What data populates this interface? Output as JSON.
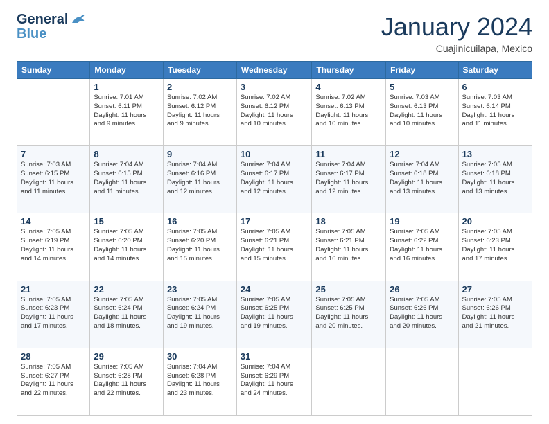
{
  "header": {
    "logo_line1": "General",
    "logo_line2": "Blue",
    "month_title": "January 2024",
    "location": "Cuajinicuilapa, Mexico"
  },
  "weekdays": [
    "Sunday",
    "Monday",
    "Tuesday",
    "Wednesday",
    "Thursday",
    "Friday",
    "Saturday"
  ],
  "weeks": [
    [
      {
        "day": "",
        "info": ""
      },
      {
        "day": "1",
        "info": "Sunrise: 7:01 AM\nSunset: 6:11 PM\nDaylight: 11 hours\nand 9 minutes."
      },
      {
        "day": "2",
        "info": "Sunrise: 7:02 AM\nSunset: 6:12 PM\nDaylight: 11 hours\nand 9 minutes."
      },
      {
        "day": "3",
        "info": "Sunrise: 7:02 AM\nSunset: 6:12 PM\nDaylight: 11 hours\nand 10 minutes."
      },
      {
        "day": "4",
        "info": "Sunrise: 7:02 AM\nSunset: 6:13 PM\nDaylight: 11 hours\nand 10 minutes."
      },
      {
        "day": "5",
        "info": "Sunrise: 7:03 AM\nSunset: 6:13 PM\nDaylight: 11 hours\nand 10 minutes."
      },
      {
        "day": "6",
        "info": "Sunrise: 7:03 AM\nSunset: 6:14 PM\nDaylight: 11 hours\nand 11 minutes."
      }
    ],
    [
      {
        "day": "7",
        "info": "Sunrise: 7:03 AM\nSunset: 6:15 PM\nDaylight: 11 hours\nand 11 minutes."
      },
      {
        "day": "8",
        "info": "Sunrise: 7:04 AM\nSunset: 6:15 PM\nDaylight: 11 hours\nand 11 minutes."
      },
      {
        "day": "9",
        "info": "Sunrise: 7:04 AM\nSunset: 6:16 PM\nDaylight: 11 hours\nand 12 minutes."
      },
      {
        "day": "10",
        "info": "Sunrise: 7:04 AM\nSunset: 6:17 PM\nDaylight: 11 hours\nand 12 minutes."
      },
      {
        "day": "11",
        "info": "Sunrise: 7:04 AM\nSunset: 6:17 PM\nDaylight: 11 hours\nand 12 minutes."
      },
      {
        "day": "12",
        "info": "Sunrise: 7:04 AM\nSunset: 6:18 PM\nDaylight: 11 hours\nand 13 minutes."
      },
      {
        "day": "13",
        "info": "Sunrise: 7:05 AM\nSunset: 6:18 PM\nDaylight: 11 hours\nand 13 minutes."
      }
    ],
    [
      {
        "day": "14",
        "info": "Sunrise: 7:05 AM\nSunset: 6:19 PM\nDaylight: 11 hours\nand 14 minutes."
      },
      {
        "day": "15",
        "info": "Sunrise: 7:05 AM\nSunset: 6:20 PM\nDaylight: 11 hours\nand 14 minutes."
      },
      {
        "day": "16",
        "info": "Sunrise: 7:05 AM\nSunset: 6:20 PM\nDaylight: 11 hours\nand 15 minutes."
      },
      {
        "day": "17",
        "info": "Sunrise: 7:05 AM\nSunset: 6:21 PM\nDaylight: 11 hours\nand 15 minutes."
      },
      {
        "day": "18",
        "info": "Sunrise: 7:05 AM\nSunset: 6:21 PM\nDaylight: 11 hours\nand 16 minutes."
      },
      {
        "day": "19",
        "info": "Sunrise: 7:05 AM\nSunset: 6:22 PM\nDaylight: 11 hours\nand 16 minutes."
      },
      {
        "day": "20",
        "info": "Sunrise: 7:05 AM\nSunset: 6:23 PM\nDaylight: 11 hours\nand 17 minutes."
      }
    ],
    [
      {
        "day": "21",
        "info": "Sunrise: 7:05 AM\nSunset: 6:23 PM\nDaylight: 11 hours\nand 17 minutes."
      },
      {
        "day": "22",
        "info": "Sunrise: 7:05 AM\nSunset: 6:24 PM\nDaylight: 11 hours\nand 18 minutes."
      },
      {
        "day": "23",
        "info": "Sunrise: 7:05 AM\nSunset: 6:24 PM\nDaylight: 11 hours\nand 19 minutes."
      },
      {
        "day": "24",
        "info": "Sunrise: 7:05 AM\nSunset: 6:25 PM\nDaylight: 11 hours\nand 19 minutes."
      },
      {
        "day": "25",
        "info": "Sunrise: 7:05 AM\nSunset: 6:25 PM\nDaylight: 11 hours\nand 20 minutes."
      },
      {
        "day": "26",
        "info": "Sunrise: 7:05 AM\nSunset: 6:26 PM\nDaylight: 11 hours\nand 20 minutes."
      },
      {
        "day": "27",
        "info": "Sunrise: 7:05 AM\nSunset: 6:26 PM\nDaylight: 11 hours\nand 21 minutes."
      }
    ],
    [
      {
        "day": "28",
        "info": "Sunrise: 7:05 AM\nSunset: 6:27 PM\nDaylight: 11 hours\nand 22 minutes."
      },
      {
        "day": "29",
        "info": "Sunrise: 7:05 AM\nSunset: 6:28 PM\nDaylight: 11 hours\nand 22 minutes."
      },
      {
        "day": "30",
        "info": "Sunrise: 7:04 AM\nSunset: 6:28 PM\nDaylight: 11 hours\nand 23 minutes."
      },
      {
        "day": "31",
        "info": "Sunrise: 7:04 AM\nSunset: 6:29 PM\nDaylight: 11 hours\nand 24 minutes."
      },
      {
        "day": "",
        "info": ""
      },
      {
        "day": "",
        "info": ""
      },
      {
        "day": "",
        "info": ""
      }
    ]
  ]
}
